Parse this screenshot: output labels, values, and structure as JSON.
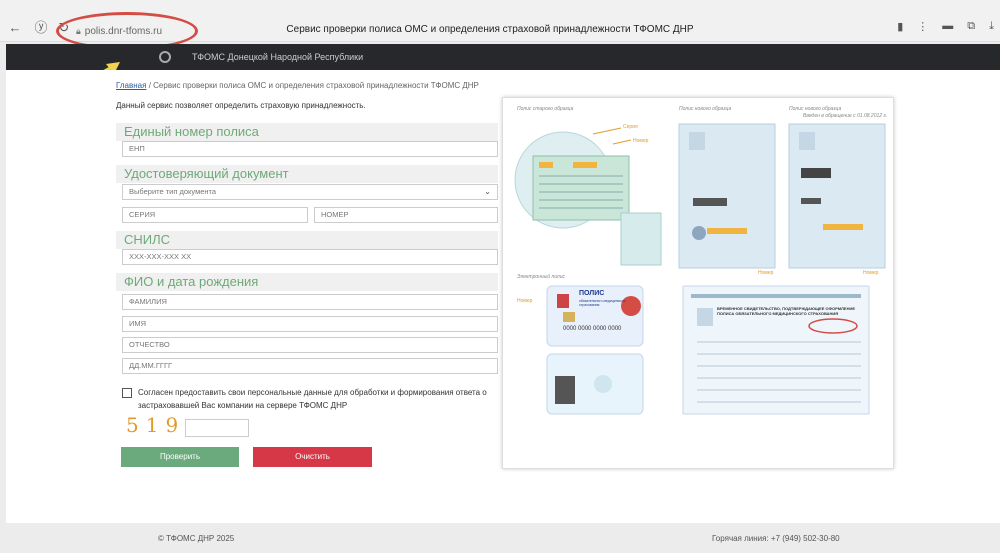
{
  "browser": {
    "url": "polis.dnr-tfoms.ru",
    "tab_title": "Сервис проверки полиса ОМС и определения страховой принадлежности ТФОМС ДНР"
  },
  "header": {
    "brand": "ТФОМС Донецкой Народной Республики"
  },
  "breadcrumb": {
    "home": "Главная",
    "sep": "/",
    "current": "Сервис проверки полиса ОМС и определения страховой принадлежности ТФОМС ДНР"
  },
  "intro": "Данный сервис позволяет определить страховую принадлежность.",
  "sections": {
    "policy": {
      "title": "Единый номер полиса",
      "enp_placeholder": "ЕНП"
    },
    "document": {
      "title": "Удостоверяющий документ",
      "type_placeholder": "Выберите тип документа",
      "series_placeholder": "СЕРИЯ",
      "number_placeholder": "НОМЕР"
    },
    "snils": {
      "title": "СНИЛС",
      "placeholder": "XXX-XXX-XXX XX"
    },
    "person": {
      "title": "ФИО и дата рождения",
      "lastname": "ФАМИЛИЯ",
      "firstname": "ИМЯ",
      "middlename": "ОТЧЕСТВО",
      "birthdate": "ДД.ММ.ГГГГ"
    }
  },
  "consent": "Согласен предоставить свои персональные данные для обработки и формирования ответа о застраховавшей Вас компании на сервере ТФОМС ДНР",
  "captcha": {
    "code": "519"
  },
  "buttons": {
    "check": "Проверить",
    "clear": "Очистить"
  },
  "samples": {
    "old": "Полис старого образца",
    "new1": "Полис нового образца",
    "new2": "Полис нового образца",
    "new2_sub": "Введен в обращение с 01.08.2012 г.",
    "electronic": "Электронный полис",
    "seria": "Серия",
    "nomer": "Номер",
    "card_title": "ПОЛИС",
    "card_sub": "обязательного медицинского страхования",
    "card_number": "0000 0000 0000 0000",
    "temp_title": "ВРЕМЕННОЕ СВИДЕТЕЛЬСТВО, ПОДТВЕРЖДАЮЩЕЕ ОФОРМЛЕНИЕ ПОЛИСА ОБЯЗАТЕЛЬНОГО МЕДИЦИНСКОГО СТРАХОВАНИЯ"
  },
  "footer": {
    "copyright": "© ТФОМС ДНР 2025",
    "hotline": "Горячая линия: +7 (949) 502-30-80"
  },
  "colors": {
    "accent_green": "#6aaa7c",
    "danger_red": "#d73848",
    "header_dark": "#26282c",
    "annotation": "#d44d45"
  }
}
